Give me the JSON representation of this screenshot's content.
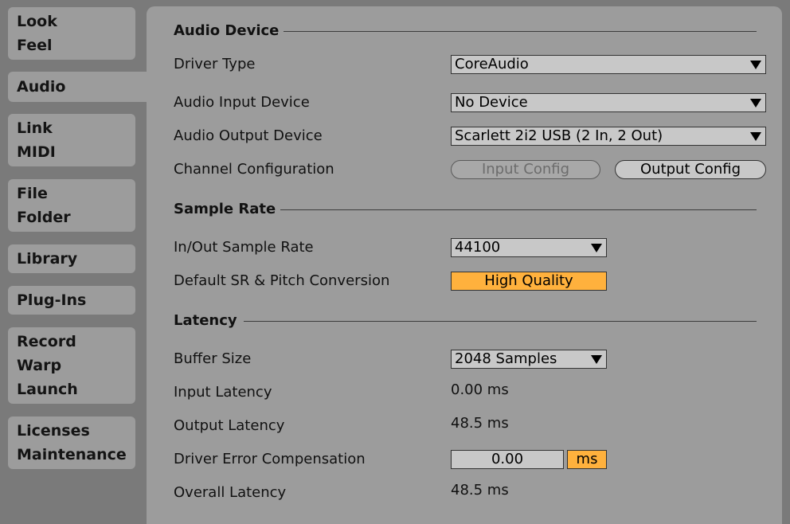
{
  "sidebar": {
    "tabs": [
      {
        "lines": [
          "Look",
          "Feel"
        ]
      },
      {
        "lines": [
          "Audio"
        ]
      },
      {
        "lines": [
          "Link",
          "MIDI"
        ]
      },
      {
        "lines": [
          "File",
          "Folder"
        ]
      },
      {
        "lines": [
          "Library"
        ]
      },
      {
        "lines": [
          "Plug-Ins"
        ]
      },
      {
        "lines": [
          "Record",
          "Warp",
          "Launch"
        ]
      },
      {
        "lines": [
          "Licenses",
          "Maintenance"
        ]
      }
    ],
    "active_tab": "Audio"
  },
  "audio_device": {
    "title": "Audio Device",
    "driver_type": {
      "label": "Driver Type",
      "value": "CoreAudio"
    },
    "input_device": {
      "label": "Audio Input Device",
      "value": "No Device"
    },
    "output_device": {
      "label": "Audio Output Device",
      "value": "Scarlett 2i2 USB (2 In, 2 Out)"
    },
    "channel_config": {
      "label": "Channel Configuration",
      "input_button": "Input Config",
      "output_button": "Output Config"
    }
  },
  "sample_rate": {
    "title": "Sample Rate",
    "in_out": {
      "label": "In/Out Sample Rate",
      "value": "44100"
    },
    "conversion": {
      "label": "Default SR & Pitch Conversion",
      "value": "High Quality"
    }
  },
  "latency": {
    "title": "Latency",
    "buffer_size": {
      "label": "Buffer Size",
      "value": "2048 Samples"
    },
    "input_latency": {
      "label": "Input Latency",
      "value": "0.00 ms"
    },
    "output_latency": {
      "label": "Output Latency",
      "value": "48.5 ms"
    },
    "driver_error": {
      "label": "Driver Error Compensation",
      "value": "0.00",
      "unit": "ms"
    },
    "overall_latency": {
      "label": "Overall Latency",
      "value": "48.5 ms"
    }
  },
  "colors": {
    "background": "#7a7a7a",
    "panel": "#9c9c9c",
    "accent_orange": "#ffb13d",
    "control_fill": "#c8c8c8"
  }
}
